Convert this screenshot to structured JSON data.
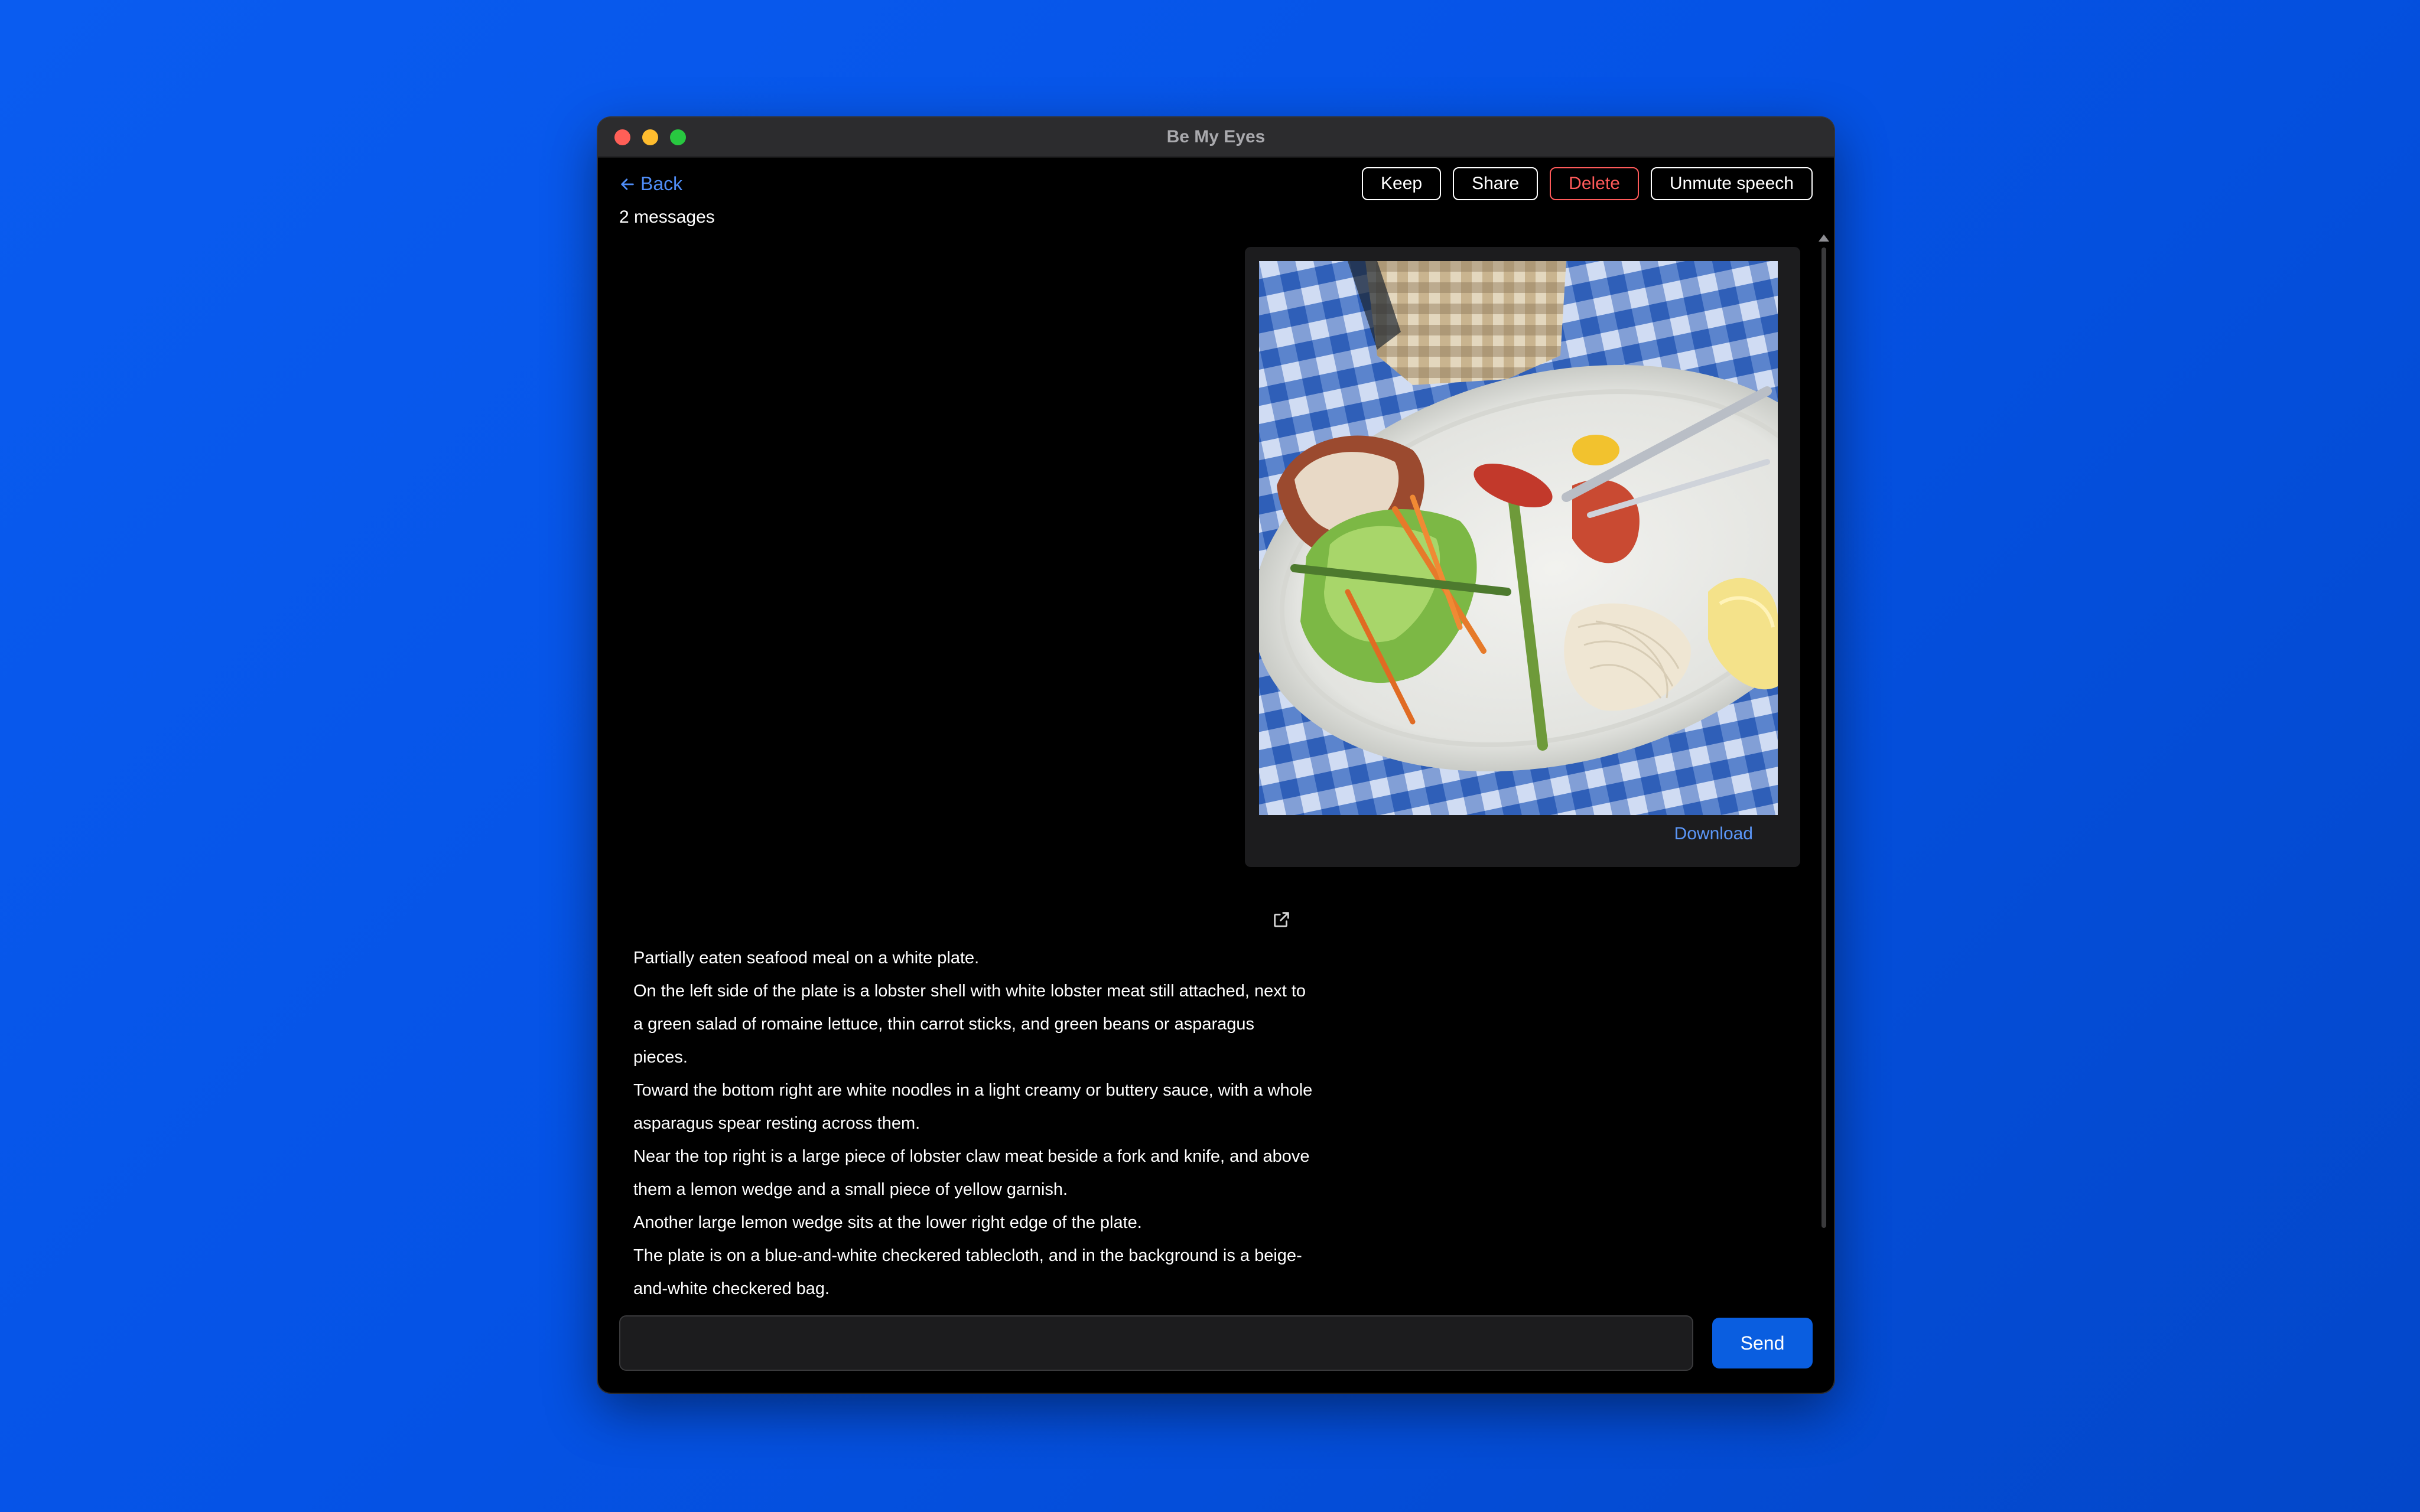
{
  "window": {
    "title": "Be My Eyes"
  },
  "header": {
    "back_label": "Back",
    "message_count": "2 messages"
  },
  "toolbar": {
    "keep_label": "Keep",
    "share_label": "Share",
    "delete_label": "Delete",
    "unmute_label": "Unmute speech"
  },
  "image_card": {
    "download_label": "Download"
  },
  "description": {
    "lines": [
      "Partially eaten seafood meal on a white plate.",
      "On the left side of the plate is a lobster shell with white lobster meat still attached, next to a green salad of romaine lettuce, thin carrot sticks, and green beans or asparagus pieces.",
      "Toward the bottom right are white noodles in a light creamy or buttery sauce, with a whole asparagus spear resting across them.",
      "Near the top right is a large piece of lobster claw meat beside a fork and knife, and above them a lemon wedge and a small piece of yellow garnish.",
      "Another large lemon wedge sits at the lower right edge of the plate.",
      "The plate is on a blue-and-white checkered tablecloth, and in the background is a beige-and-white checkered bag."
    ]
  },
  "composer": {
    "value": "",
    "send_label": "Send"
  },
  "colors": {
    "accent": "#0a5ee0",
    "link": "#4f8df7",
    "danger": "#ff5a5a",
    "background_gradient": "#0553e6"
  }
}
